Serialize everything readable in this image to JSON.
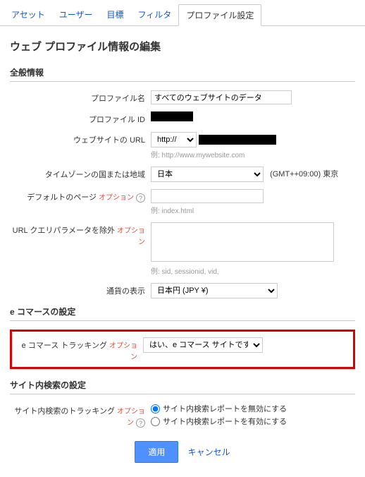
{
  "tabs": {
    "asset": "アセット",
    "user": "ユーザー",
    "goal": "目標",
    "filter": "フィルタ",
    "profile": "プロファイル設定"
  },
  "page_title": "ウェブ プロファイル情報の編集",
  "sections": {
    "general": "全般情報",
    "ecommerce": "e コマースの設定",
    "sitesearch": "サイト内検索の設定"
  },
  "labels": {
    "profile_name": "プロファイル名",
    "profile_id": "プロファイル ID",
    "website_url": "ウェブサイトの URL",
    "timezone": "タイムゾーンの国または地域",
    "default_page": "デフォルトのページ",
    "url_query_exclude": "URL クエリパラメータを除外",
    "currency": "通貨の表示",
    "ecommerce_tracking": "e コマース トラッキング",
    "sitesearch_tracking": "サイト内検索のトラッキング",
    "option": "オプション"
  },
  "values": {
    "profile_name": "すべてのウェブサイトのデータ",
    "scheme": "http://",
    "timezone_country": "日本",
    "timezone_offset": "(GMT++09:00) 東京",
    "currency": "日本円 (JPY ¥)",
    "ecommerce_tracking": "はい、e コマース サイトです",
    "sitesearch_disable": "サイト内検索レポートを無効にする",
    "sitesearch_enable": "サイト内検索レポートを有効にする"
  },
  "hints": {
    "website_url": "例: http://www.mywebsite.com",
    "default_page": "例: index.html",
    "url_query_exclude": "例: sid, sessionid, vid,"
  },
  "actions": {
    "apply": "適用",
    "cancel": "キャンセル"
  }
}
